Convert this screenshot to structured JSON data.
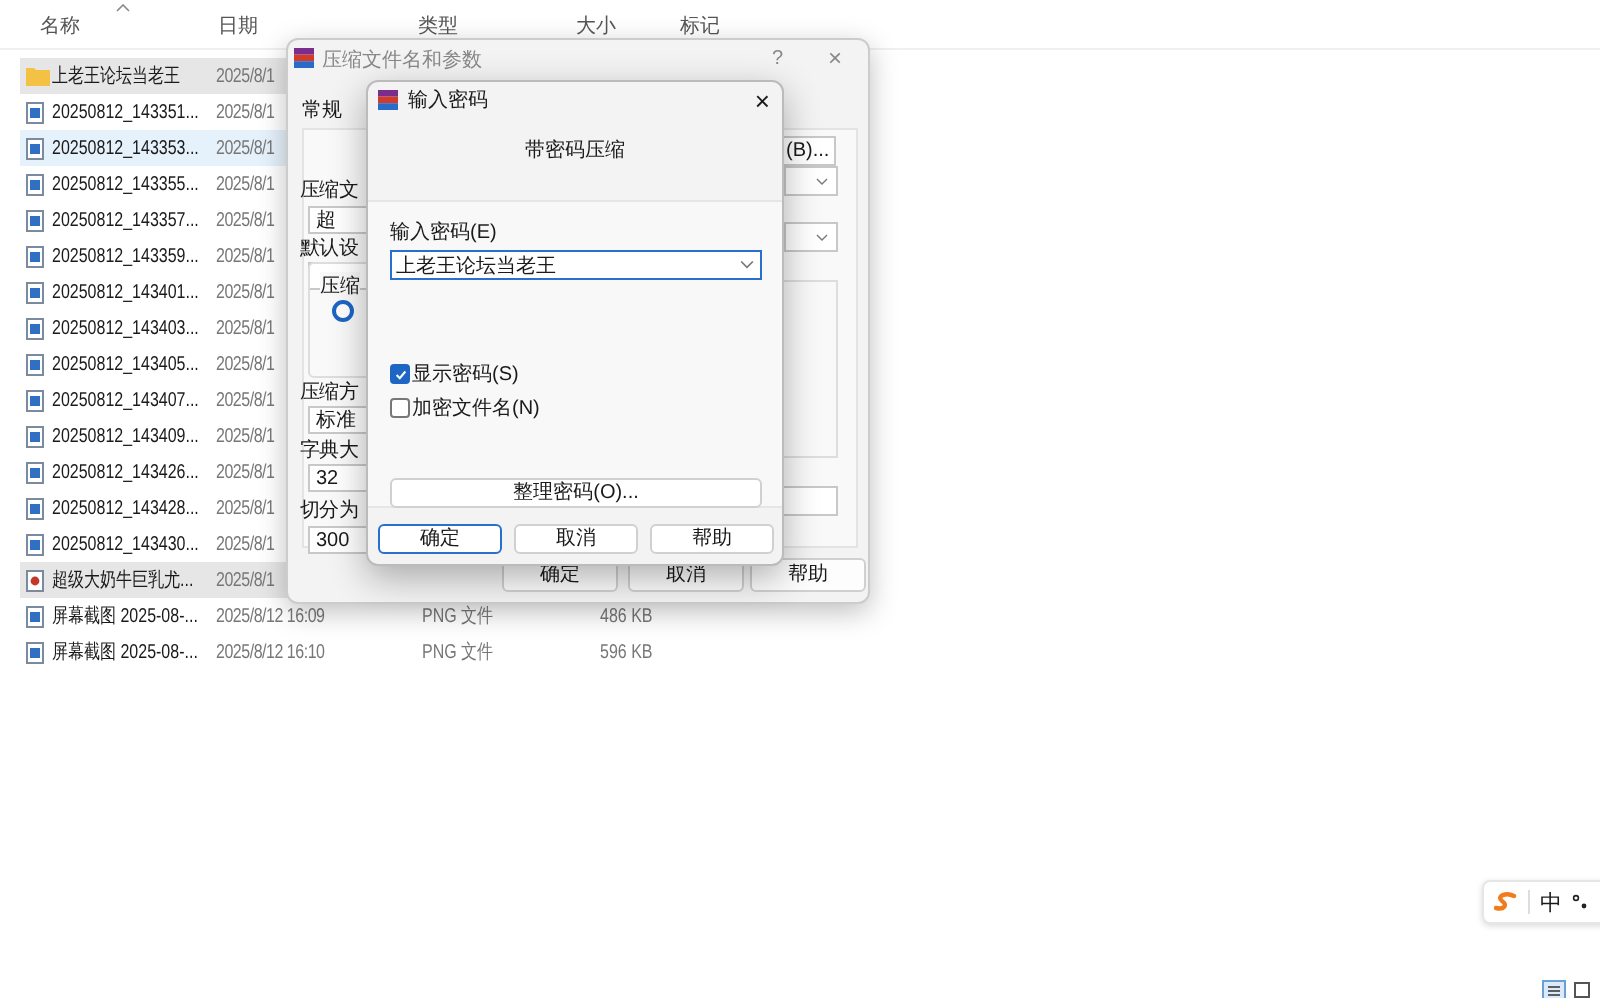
{
  "explorer": {
    "columns": [
      "名称",
      "日期",
      "类型",
      "大小",
      "标记"
    ],
    "rows": [
      {
        "kind": "folder",
        "name": "上老王论坛当老王",
        "date": "2025/8/1",
        "selected": true,
        "hovered": false
      },
      {
        "kind": "image",
        "name": "20250812_143351...",
        "date": "2025/8/1",
        "selected": false,
        "hovered": false
      },
      {
        "kind": "image",
        "name": "20250812_143353...",
        "date": "2025/8/1",
        "selected": false,
        "hovered": true
      },
      {
        "kind": "image",
        "name": "20250812_143355...",
        "date": "2025/8/1",
        "selected": false,
        "hovered": false
      },
      {
        "kind": "image",
        "name": "20250812_143357...",
        "date": "2025/8/1",
        "selected": false,
        "hovered": false
      },
      {
        "kind": "image",
        "name": "20250812_143359...",
        "date": "2025/8/1",
        "selected": false,
        "hovered": false
      },
      {
        "kind": "image",
        "name": "20250812_143401...",
        "date": "2025/8/1",
        "selected": false,
        "hovered": false
      },
      {
        "kind": "image",
        "name": "20250812_143403...",
        "date": "2025/8/1",
        "selected": false,
        "hovered": false
      },
      {
        "kind": "image",
        "name": "20250812_143405...",
        "date": "2025/8/1",
        "selected": false,
        "hovered": false
      },
      {
        "kind": "image",
        "name": "20250812_143407...",
        "date": "2025/8/1",
        "selected": false,
        "hovered": false
      },
      {
        "kind": "image",
        "name": "20250812_143409...",
        "date": "2025/8/1",
        "selected": false,
        "hovered": false
      },
      {
        "kind": "image",
        "name": "20250812_143426...",
        "date": "2025/8/1",
        "selected": false,
        "hovered": false
      },
      {
        "kind": "image",
        "name": "20250812_143428...",
        "date": "2025/8/1",
        "selected": false,
        "hovered": false
      },
      {
        "kind": "image",
        "name": "20250812_143430...",
        "date": "2025/8/1",
        "selected": false,
        "hovered": false
      },
      {
        "kind": "video",
        "name": "超级大奶牛巨乳尤...",
        "date": "2025/8/1",
        "selected": true,
        "hovered": false
      },
      {
        "kind": "image",
        "name": "屏幕截图 2025-08-...",
        "date": "2025/8/12 16:09",
        "type": "PNG 文件",
        "size": "486 KB",
        "selected": false,
        "hovered": false
      },
      {
        "kind": "image",
        "name": "屏幕截图 2025-08-...",
        "date": "2025/8/12 16:10",
        "type": "PNG 文件",
        "size": "596 KB",
        "selected": false,
        "hovered": false
      }
    ]
  },
  "archive_dialog": {
    "title": "压缩文件名和参数",
    "help": "?",
    "close": "×",
    "tab": "常规",
    "browse": "(B)...",
    "form_rows": [
      {
        "label": "压缩文",
        "value": "超"
      },
      {
        "label": "默认设"
      },
      {
        "label": "压缩方",
        "value": "标准"
      },
      {
        "label": "字典大",
        "value": "32"
      },
      {
        "label": "切分为",
        "value": "300"
      }
    ],
    "group_label": "压缩",
    "radio_selected": true,
    "buttons": [
      "确定",
      "取消",
      "帮助"
    ]
  },
  "password_dialog": {
    "title": "输入密码",
    "close": "×",
    "heading": "带密码压缩",
    "password_label": "输入密码(E)",
    "password_value": "上老王论坛当老王",
    "checkboxes": [
      {
        "label": "显示密码(S)",
        "checked": true
      },
      {
        "label": "加密文件名(N)",
        "checked": false
      }
    ],
    "organize": "整理密码(O)...",
    "buttons": [
      {
        "label": "确定",
        "default": true
      },
      {
        "label": "取消",
        "default": false
      },
      {
        "label": "帮助",
        "default": false
      }
    ]
  },
  "ime_bar": {
    "mode": "中"
  }
}
